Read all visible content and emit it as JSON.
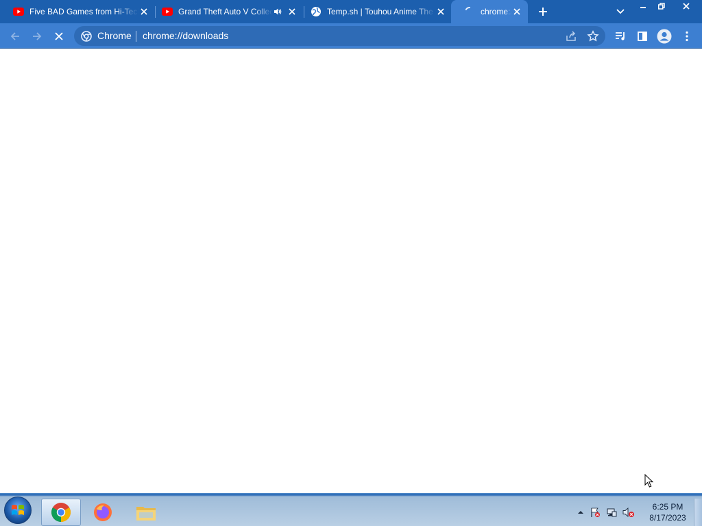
{
  "window": {
    "tabs": [
      {
        "title": "Five BAD Games from Hi-Tech",
        "favicon": "youtube-icon",
        "active": false,
        "audio": false
      },
      {
        "title": "Grand Theft Auto V Collector",
        "favicon": "youtube-icon",
        "active": false,
        "audio": true
      },
      {
        "title": "Temp.sh | Touhou Anime The",
        "favicon": "globe-icon",
        "active": false,
        "audio": false
      },
      {
        "title": "chrome://downloads",
        "favicon": "loading-spinner-icon",
        "active": true,
        "audio": false
      }
    ],
    "new_tab_icon": "plus-icon",
    "tab_search_icon": "chevron-down-icon",
    "controls": [
      "minimize-icon",
      "restore-icon",
      "close-icon"
    ]
  },
  "toolbar": {
    "back_icon": "arrow-left-icon",
    "forward_icon": "arrow-right-icon",
    "stop_icon": "close-icon",
    "omnibox": {
      "site_chip": "Chrome",
      "url": "chrome://downloads",
      "share_icon": "share-icon",
      "bookmark_icon": "star-icon"
    },
    "media_icon": "media-queue-icon",
    "side_panel_icon": "side-panel-icon",
    "profile_icon": "avatar-icon",
    "menu_icon": "kebab-menu-icon"
  },
  "colors": {
    "frame": "#1c5fae",
    "toolbar": "#3d7fd1",
    "omnibox": "#2e6bb6",
    "text": "#ffffff"
  },
  "taskbar": {
    "start_icon": "windows-logo-icon",
    "apps": [
      {
        "name": "chrome-icon",
        "active": true
      },
      {
        "name": "firefox-icon",
        "active": false
      },
      {
        "name": "file-explorer-icon",
        "active": false
      }
    ],
    "tray_icons": [
      "show-hidden-icons-arrow",
      "action-center-flag-icon",
      "network-icon",
      "volume-muted-icon"
    ],
    "clock": {
      "time": "6:25 PM",
      "date": "8/17/2023"
    }
  }
}
